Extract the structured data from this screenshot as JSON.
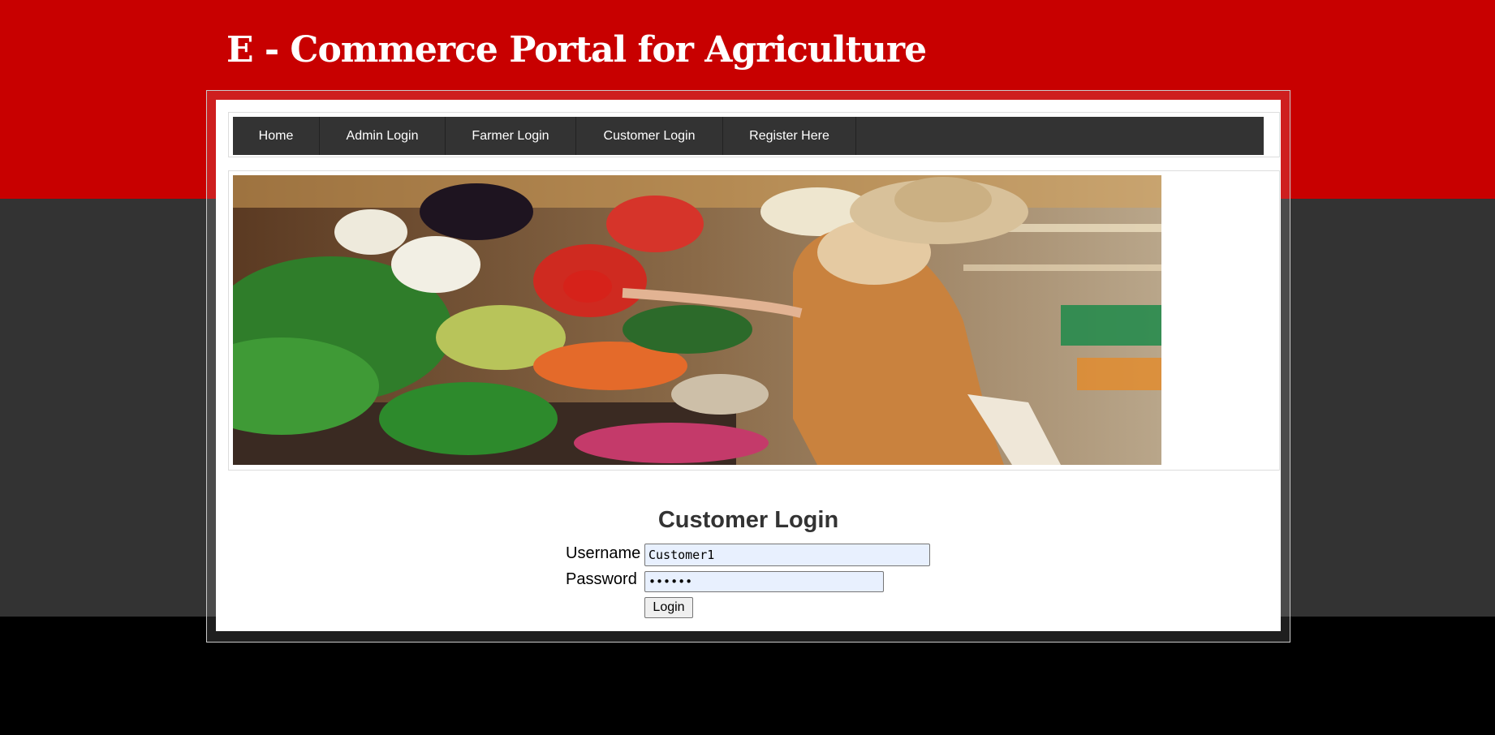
{
  "site": {
    "title": "E - Commerce Portal for Agriculture"
  },
  "nav": {
    "items": [
      {
        "label": "Home"
      },
      {
        "label": "Admin Login"
      },
      {
        "label": "Farmer Login"
      },
      {
        "label": "Customer Login"
      },
      {
        "label": "Register Here"
      }
    ]
  },
  "login": {
    "title": "Customer Login",
    "username_label": "Username",
    "username_value": "Customer1",
    "password_label": "Password",
    "password_value": "••••••",
    "button_label": "Login"
  },
  "colors": {
    "header_red": "#c80000",
    "band_gray": "#333333",
    "footer_black": "#000000",
    "nav_bg": "#333333"
  }
}
